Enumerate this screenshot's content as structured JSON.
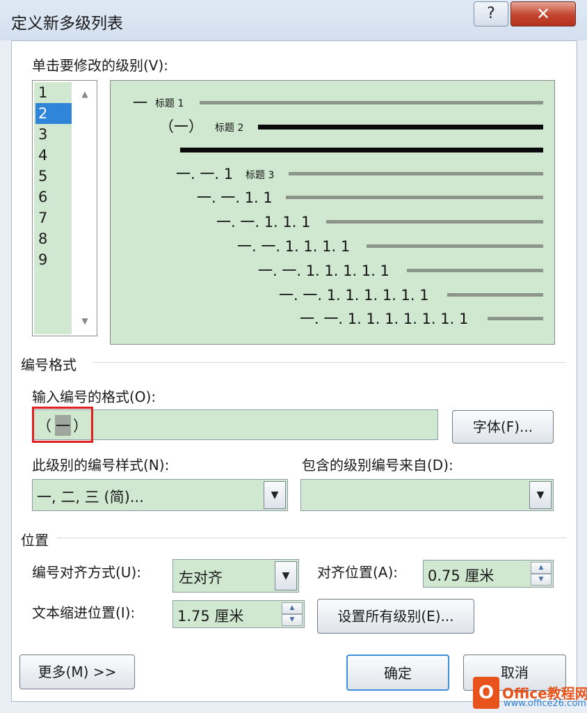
{
  "window": {
    "title": "定义新多级列表",
    "help_glyph": "?",
    "close_glyph": "✕"
  },
  "levels": {
    "label": "单击要修改的级别(V):",
    "items": [
      "1",
      "2",
      "3",
      "4",
      "5",
      "6",
      "7",
      "8",
      "9"
    ],
    "selected": "2"
  },
  "preview": {
    "rows": [
      {
        "num": "一",
        "caption": "标题 1"
      },
      {
        "num": "（一）",
        "caption": "标题 2"
      },
      {
        "num": "一. 一. 1",
        "caption": "标题 3"
      },
      {
        "num": "一. 一. 1. 1",
        "caption": ""
      },
      {
        "num": "一. 一. 1. 1. 1",
        "caption": ""
      },
      {
        "num": "一. 一. 1. 1. 1. 1",
        "caption": ""
      },
      {
        "num": "一. 一. 1. 1. 1. 1. 1",
        "caption": ""
      },
      {
        "num": "一. 一. 1. 1. 1. 1. 1. 1",
        "caption": ""
      },
      {
        "num": "一. 一. 1. 1. 1. 1. 1. 1. 1",
        "caption": ""
      }
    ]
  },
  "number_format": {
    "section": "编号格式",
    "input_label": "输入编号的格式(O):",
    "format_open": "（",
    "format_num": "一",
    "format_close": "）",
    "font_button": "字体(F)...",
    "style_label": "此级别的编号样式(N):",
    "style_value": "一, 二, 三 (简)...",
    "include_label": "包含的级别编号来自(D):",
    "include_value": ""
  },
  "position": {
    "section": "位置",
    "align_label": "编号对齐方式(U):",
    "align_value": "左对齐",
    "align_at_label": "对齐位置(A):",
    "align_at_value": "0.75 厘米",
    "indent_label": "文本缩进位置(I):",
    "indent_value": "1.75 厘米",
    "set_all_button": "设置所有级别(E)..."
  },
  "footer": {
    "more_button": "更多(M) >>",
    "ok_button": "确定",
    "cancel_button": "取消"
  },
  "watermark": {
    "logo_letter": "O",
    "brand": "Office教程网",
    "url": "www.office26.com"
  },
  "colors": {
    "field_green": "#cfe8cf",
    "selection_blue": "#2f86d9",
    "highlight_red": "#e02020",
    "close_red": "#c2442d"
  }
}
